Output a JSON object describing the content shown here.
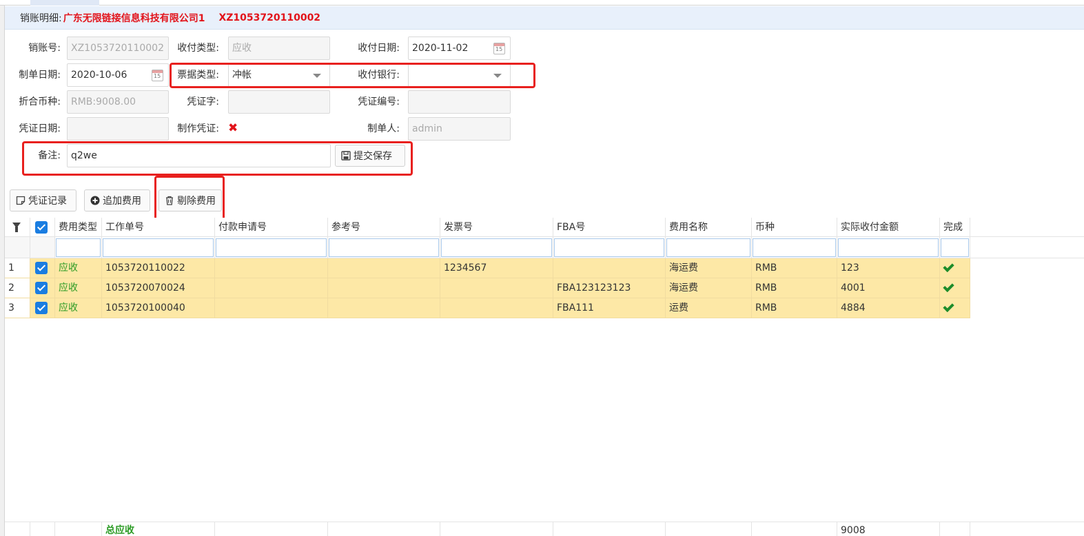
{
  "title": {
    "label": "销账明细:",
    "company": "广东无限链接信息科技有限公司1",
    "code": "XZ1053720110002"
  },
  "form": {
    "account_no": {
      "label": "销账号:",
      "value": "XZ1053720110002"
    },
    "pay_type": {
      "label": "收付类型:",
      "value": "应收"
    },
    "pay_date": {
      "label": "收付日期:",
      "value": "2020-11-02"
    },
    "create_date": {
      "label": "制单日期:",
      "value": "2020-10-06"
    },
    "bill_type": {
      "label": "票据类型:",
      "value": "冲帐"
    },
    "bank": {
      "label": "收付银行:",
      "value": ""
    },
    "currency": {
      "label": "折合币种:",
      "value": "RMB:9008.00"
    },
    "voucher_word": {
      "label": "凭证字:",
      "value": ""
    },
    "voucher_no": {
      "label": "凭证编号:",
      "value": ""
    },
    "voucher_date": {
      "label": "凭证日期:",
      "value": ""
    },
    "make_voucher": {
      "label": "制作凭证:",
      "value": "✖"
    },
    "creator": {
      "label": "制单人:",
      "value": "admin"
    },
    "remark": {
      "label": "备注:",
      "value": "q2we"
    },
    "submit_label": "提交保存",
    "calendar_day": "15"
  },
  "toolbar": {
    "voucher_record": "凭证记录",
    "add_fee": "追加费用",
    "delete_fee": "剔除费用"
  },
  "columns": [
    "费用类型",
    "工作单号",
    "付款申请号",
    "参考号",
    "发票号",
    "FBA号",
    "费用名称",
    "币种",
    "实际收付金额",
    "完成"
  ],
  "rows": [
    {
      "num": "1",
      "type": "应收",
      "job": "1053720110022",
      "apply": "",
      "ref": "",
      "invoice": "1234567",
      "fba": "",
      "fee": "海运费",
      "cur": "RMB",
      "amount": "123"
    },
    {
      "num": "2",
      "type": "应收",
      "job": "1053720070024",
      "apply": "",
      "ref": "",
      "invoice": "",
      "fba": "FBA123123123",
      "fee": "海运费",
      "cur": "RMB",
      "amount": "4001"
    },
    {
      "num": "3",
      "type": "应收",
      "job": "1053720100040",
      "apply": "",
      "ref": "",
      "invoice": "",
      "fba": "FBA111",
      "fee": "运费",
      "cur": "RMB",
      "amount": "4884"
    }
  ],
  "summary": {
    "label": "总应收",
    "amount": "9008"
  },
  "colors": {
    "accent": "#1a7de1",
    "highlight_row": "#fde8a6",
    "alert_red": "#e2141b",
    "success_green": "#1e8c2b"
  }
}
